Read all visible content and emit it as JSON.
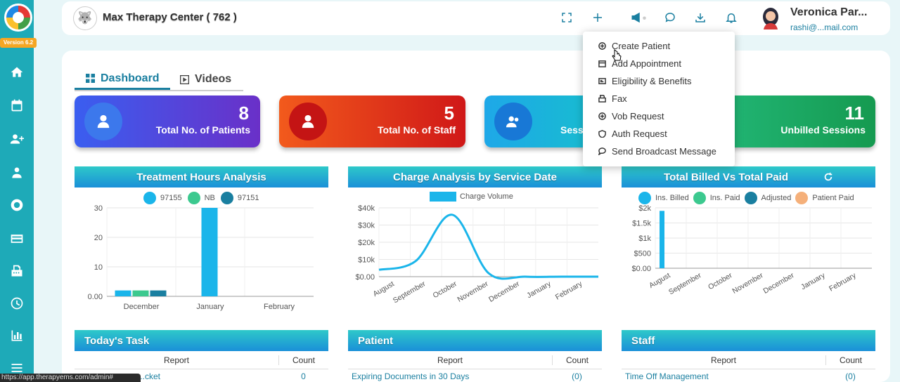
{
  "sidebar": {
    "version": "Version 6.2",
    "icons": [
      "home-icon",
      "calendar-icon",
      "add-user-icon",
      "users-icon",
      "settings-cycle-icon",
      "credit-card-icon",
      "fax-icon",
      "clock-icon",
      "bar-chart-icon",
      "menu-icon"
    ]
  },
  "header": {
    "org_name": "Max Therapy Center ( 762 )",
    "user_name": "Veronica Par...",
    "user_email": "rashi@...mail.com",
    "icons": [
      "fullscreen-icon",
      "plus-icon",
      "megaphone-icon",
      "chat-icon",
      "download-icon",
      "bell-icon"
    ]
  },
  "tabs": [
    {
      "label": "Dashboard"
    },
    {
      "label": "Videos"
    }
  ],
  "cards": [
    {
      "value": "8",
      "label": "Total No. of Patients"
    },
    {
      "value": "5",
      "label": "Total No. of Staff"
    },
    {
      "value": "",
      "label": "Sessi"
    },
    {
      "value": "11",
      "label": "Unbilled Sessions"
    }
  ],
  "dropdown": {
    "items": [
      "Create Patient",
      "Add Appointment",
      "Eligibility & Benefits",
      "Fax",
      "Vob Request",
      "Auth Request",
      "Send Broadcast Message"
    ]
  },
  "panels": {
    "treatment": "Treatment Hours Analysis",
    "charge": "Charge Analysis by Service Date",
    "billed": "Total Billed Vs Total Paid",
    "task": "Today's Task",
    "patient": "Patient",
    "staff": "Staff"
  },
  "tables": {
    "report_header": "Report",
    "count_header": "Count",
    "task_row": {
      "report": "...cket",
      "count": "0"
    },
    "patient_row": {
      "report": "Expiring Documents in 30 Days",
      "count": "(0)"
    },
    "staff_row": {
      "report": "Time Off Management",
      "count": "(0)"
    }
  },
  "statusbar": "https://app.therapyems.com/admin#",
  "chart_data": [
    {
      "type": "bar",
      "title": "Treatment Hours Analysis",
      "categories": [
        "December",
        "January",
        "February"
      ],
      "series": [
        {
          "name": "97155",
          "color": "#1ab5ea",
          "values": [
            2,
            30,
            0
          ]
        },
        {
          "name": "NB",
          "color": "#3cc98f",
          "values": [
            2,
            0,
            0
          ]
        },
        {
          "name": "97151",
          "color": "#1a7fa0",
          "values": [
            2,
            0,
            0
          ]
        }
      ],
      "ylim": [
        0,
        30
      ],
      "yticks": [
        "0.00",
        "10",
        "20",
        "30"
      ],
      "grid": true,
      "legend": "top"
    },
    {
      "type": "line",
      "title": "Charge Analysis by Service Date",
      "categories": [
        "August",
        "September",
        "October",
        "November",
        "December",
        "January",
        "February"
      ],
      "series": [
        {
          "name": "Charge Volume",
          "color": "#1ab5ea",
          "values": [
            4000,
            9000,
            36000,
            2000,
            0,
            0,
            0
          ]
        }
      ],
      "ylim": [
        0,
        40000
      ],
      "yticks": [
        "$0.00",
        "$10k",
        "$20k",
        "$30k",
        "$40k"
      ],
      "grid": true,
      "legend": "top"
    },
    {
      "type": "bar",
      "title": "Total Billed Vs Total Paid",
      "categories": [
        "August",
        "September",
        "October",
        "November",
        "December",
        "January",
        "February"
      ],
      "series": [
        {
          "name": "Ins. Billed",
          "color": "#1ab5ea",
          "values": [
            1900,
            0,
            0,
            0,
            0,
            0,
            0
          ]
        },
        {
          "name": "Ins. Paid",
          "color": "#3cc98f",
          "values": [
            0,
            0,
            0,
            0,
            0,
            0,
            0
          ]
        },
        {
          "name": "Adjusted",
          "color": "#1a7fa0",
          "values": [
            0,
            0,
            0,
            0,
            0,
            0,
            0
          ]
        },
        {
          "name": "Patient Paid",
          "color": "#f5b07a",
          "values": [
            0,
            0,
            0,
            0,
            0,
            0,
            0
          ]
        }
      ],
      "ylim": [
        0,
        2000
      ],
      "yticks": [
        "$0.00",
        "$500",
        "$1k",
        "$1.5k",
        "$2k"
      ],
      "grid": true,
      "legend": "top"
    }
  ]
}
